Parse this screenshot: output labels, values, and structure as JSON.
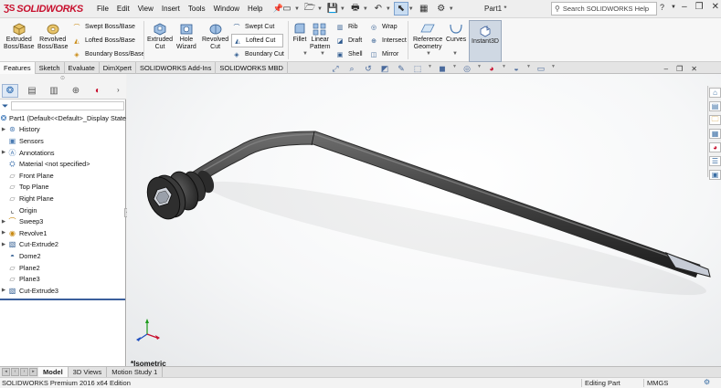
{
  "app": {
    "logo_text": "SOLIDWORKS",
    "document_title": "Part1 *"
  },
  "menu": [
    "File",
    "Edit",
    "View",
    "Insert",
    "Tools",
    "Window",
    "Help"
  ],
  "search": {
    "placeholder": "Search SOLIDWORKS Help"
  },
  "ribbon": {
    "extruded_boss": "Extruded\nBoss/Base",
    "revolved_boss": "Revolved\nBoss/Base",
    "swept_boss": "Swept Boss/Base",
    "lofted_boss": "Lofted Boss/Base",
    "boundary_boss": "Boundary Boss/Base",
    "extruded_cut": "Extruded\nCut",
    "hole_wizard": "Hole\nWizard",
    "revolved_cut": "Revolved\nCut",
    "swept_cut": "Swept Cut",
    "lofted_cut": "Lofted Cut",
    "boundary_cut": "Boundary Cut",
    "fillet": "Fillet",
    "linear_pattern": "Linear\nPattern",
    "rib": "Rib",
    "draft": "Draft",
    "shell": "Shell",
    "wrap": "Wrap",
    "intersect": "Intersect",
    "mirror": "Mirror",
    "reference_geometry": "Reference\nGeometry",
    "curves": "Curves",
    "instant3d": "Instant3D"
  },
  "tabs": [
    "Features",
    "Sketch",
    "Evaluate",
    "DimXpert",
    "SOLIDWORKS Add-Ins",
    "SOLIDWORKS MBD"
  ],
  "active_tab": "Features",
  "tree": {
    "root": "Part1  (Default<<Default>_Display State",
    "items": [
      {
        "label": "History",
        "expandable": true
      },
      {
        "label": "Sensors",
        "expandable": false
      },
      {
        "label": "Annotations",
        "expandable": true
      },
      {
        "label": "Material <not specified>",
        "expandable": false
      },
      {
        "label": "Front Plane",
        "expandable": false
      },
      {
        "label": "Top Plane",
        "expandable": false
      },
      {
        "label": "Right Plane",
        "expandable": false
      },
      {
        "label": "Origin",
        "expandable": false
      },
      {
        "label": "Sweep3",
        "expandable": true
      },
      {
        "label": "Revolve1",
        "expandable": true
      },
      {
        "label": "Cut-Extrude2",
        "expandable": true
      },
      {
        "label": "Dome2",
        "expandable": false
      },
      {
        "label": "Plane2",
        "expandable": false
      },
      {
        "label": "Plane3",
        "expandable": false
      },
      {
        "label": "Cut-Extrude3",
        "expandable": true
      }
    ]
  },
  "view": {
    "orientation_label": "*Isometric"
  },
  "model_tabs": [
    "Model",
    "3D Views",
    "Motion Study 1"
  ],
  "active_model_tab": "Model",
  "status": {
    "left": "SOLIDWORKS Premium 2016 x64 Edition",
    "mode": "Editing Part",
    "units": "MMGS"
  },
  "colors": {
    "brand_red": "#c8102e",
    "selection_blue": "#3b5f9c",
    "model_gray": "#3a3a3a"
  }
}
